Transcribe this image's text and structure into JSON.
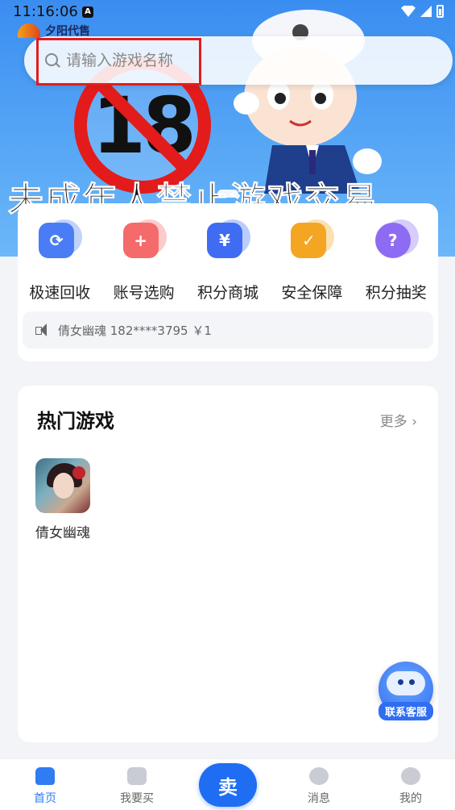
{
  "status_bar": {
    "time": "11:16:06",
    "indicator": "A"
  },
  "logo": {
    "text": "夕阳代售"
  },
  "search": {
    "placeholder": "请输入游戏名称",
    "icon": "search-icon"
  },
  "banner": {
    "number": "18",
    "slogan": "未成年人禁止游戏交易"
  },
  "quick_actions": [
    {
      "label": "极速回收",
      "icon": "recycle-icon",
      "color": "#4a7df5",
      "glyph": "⟳"
    },
    {
      "label": "账号选购",
      "icon": "gamepad-icon",
      "color": "#f56a6a",
      "glyph": "+"
    },
    {
      "label": "积分商城",
      "icon": "yen-icon",
      "color": "#3f6cf2",
      "glyph": "¥"
    },
    {
      "label": "安全保障",
      "icon": "shield-check-icon",
      "color": "#f4a623",
      "glyph": "✓"
    },
    {
      "label": "积分抽奖",
      "icon": "question-icon",
      "color": "#8d6cf3",
      "glyph": "?"
    }
  ],
  "notice": {
    "text": "倩女幽魂 182****3795 ￥1",
    "icon": "speaker-icon"
  },
  "hot_games": {
    "title": "热门游戏",
    "more": "更多",
    "games": [
      {
        "name": "倩女幽魂"
      }
    ]
  },
  "customer_service": {
    "label": "联系客服"
  },
  "tabs": [
    {
      "label": "首页",
      "icon": "home-icon",
      "active": true
    },
    {
      "label": "我要买",
      "icon": "cart-icon",
      "active": false
    },
    {
      "label": "卖",
      "icon": "sell-icon",
      "active": false
    },
    {
      "label": "消息",
      "icon": "message-icon",
      "active": false
    },
    {
      "label": "我的",
      "icon": "profile-icon",
      "active": false
    }
  ]
}
